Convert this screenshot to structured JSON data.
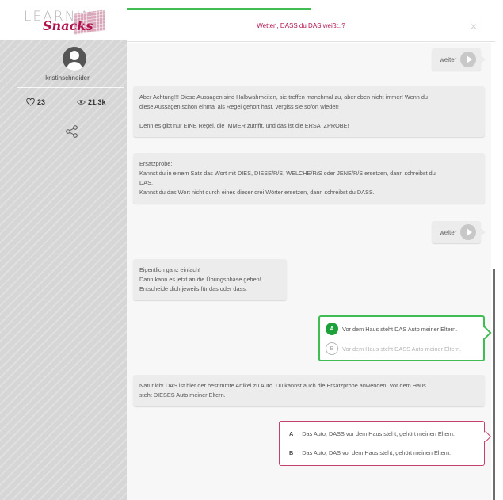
{
  "brand": {
    "learning": "LEARNING",
    "snacks": "Snacks"
  },
  "colors": {
    "accent": "#b1134f",
    "success": "#3fbc52",
    "sidebar": "#d6d6d6"
  },
  "profile": {
    "username": "kristinschneider",
    "likes": "23",
    "views": "21.3k"
  },
  "header": {
    "title": "Wetten, DASS du DAS weißt..?",
    "close_symbol": "×",
    "progress_fraction": 0.5
  },
  "chat": {
    "weiter_label": "weiter",
    "msg1": {
      "line1": "Aber Achtung!!! Diese Aussagen sind Halbwahrheiten, sie treffen manchmal zu, aber eben nicht immer! Wenn du",
      "line2": "diese Aussagen schon einmal als Regel gehört hast, vergiss sie sofort wieder!",
      "line3": "Denn es gibt nur EINE Regel, die IMMER zutrifft, und das ist die ERSATZPROBE!"
    },
    "msg2": {
      "line1": "Ersatzprobe:",
      "line2": "Kannst du in einem Satz das Wort mit DIES, DIESE/R/S, WELCHE/R/S oder JENE/R/S ersetzen, dann schreibst du",
      "line3": "DAS.",
      "line4": "Kannst du das Wort nicht durch eines dieser drei Wörter ersetzen, dann schreibst du DASS."
    },
    "msg3": {
      "line1": "Eigentlich ganz einfach!",
      "line2": "Dann kann es jetzt an die Übungsphase gehen!",
      "line3": "Entscheide dich jeweils für das oder dass."
    },
    "answer1": {
      "a_letter": "A",
      "a_text": "Vor dem Haus steht DAS Auto meiner Eltern.",
      "b_letter": "B",
      "b_text": "Vor dem Haus steht DASS Auto meiner Eltern."
    },
    "msg4": {
      "line1": "Natürlich! DAS ist hier der bestimmte Artikel zu Auto. Du kannst auch die Ersatzprobe anwenden: Vor dem Haus",
      "line2": "steht DIESES Auto meiner Eltern."
    },
    "answer2": {
      "a_letter": "A",
      "a_text": "Das Auto, DASS vor dem Haus steht, gehört meinen Eltern.",
      "b_letter": "B",
      "b_text": "Das Auto, DAS vor dem Haus steht, gehört meinen Eltern."
    }
  }
}
